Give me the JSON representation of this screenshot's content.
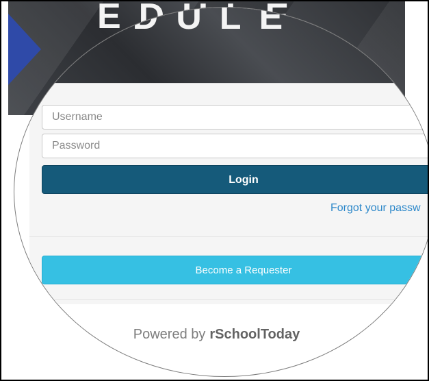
{
  "banner": {
    "title_fragment": "EDULE"
  },
  "login_form": {
    "username_placeholder": "Username",
    "password_placeholder": "Password",
    "login_label": "Login",
    "forgot_label": "Forgot your passw"
  },
  "requester": {
    "label": "Become a Requester"
  },
  "footer": {
    "powered_prefix": "Powered by",
    "brand": "rSchoolToday"
  },
  "colors": {
    "login_button": "#155a7a",
    "requester_button": "#36c0e3",
    "link": "#2b87c9",
    "banner_arrow": "#2f4aa8"
  }
}
